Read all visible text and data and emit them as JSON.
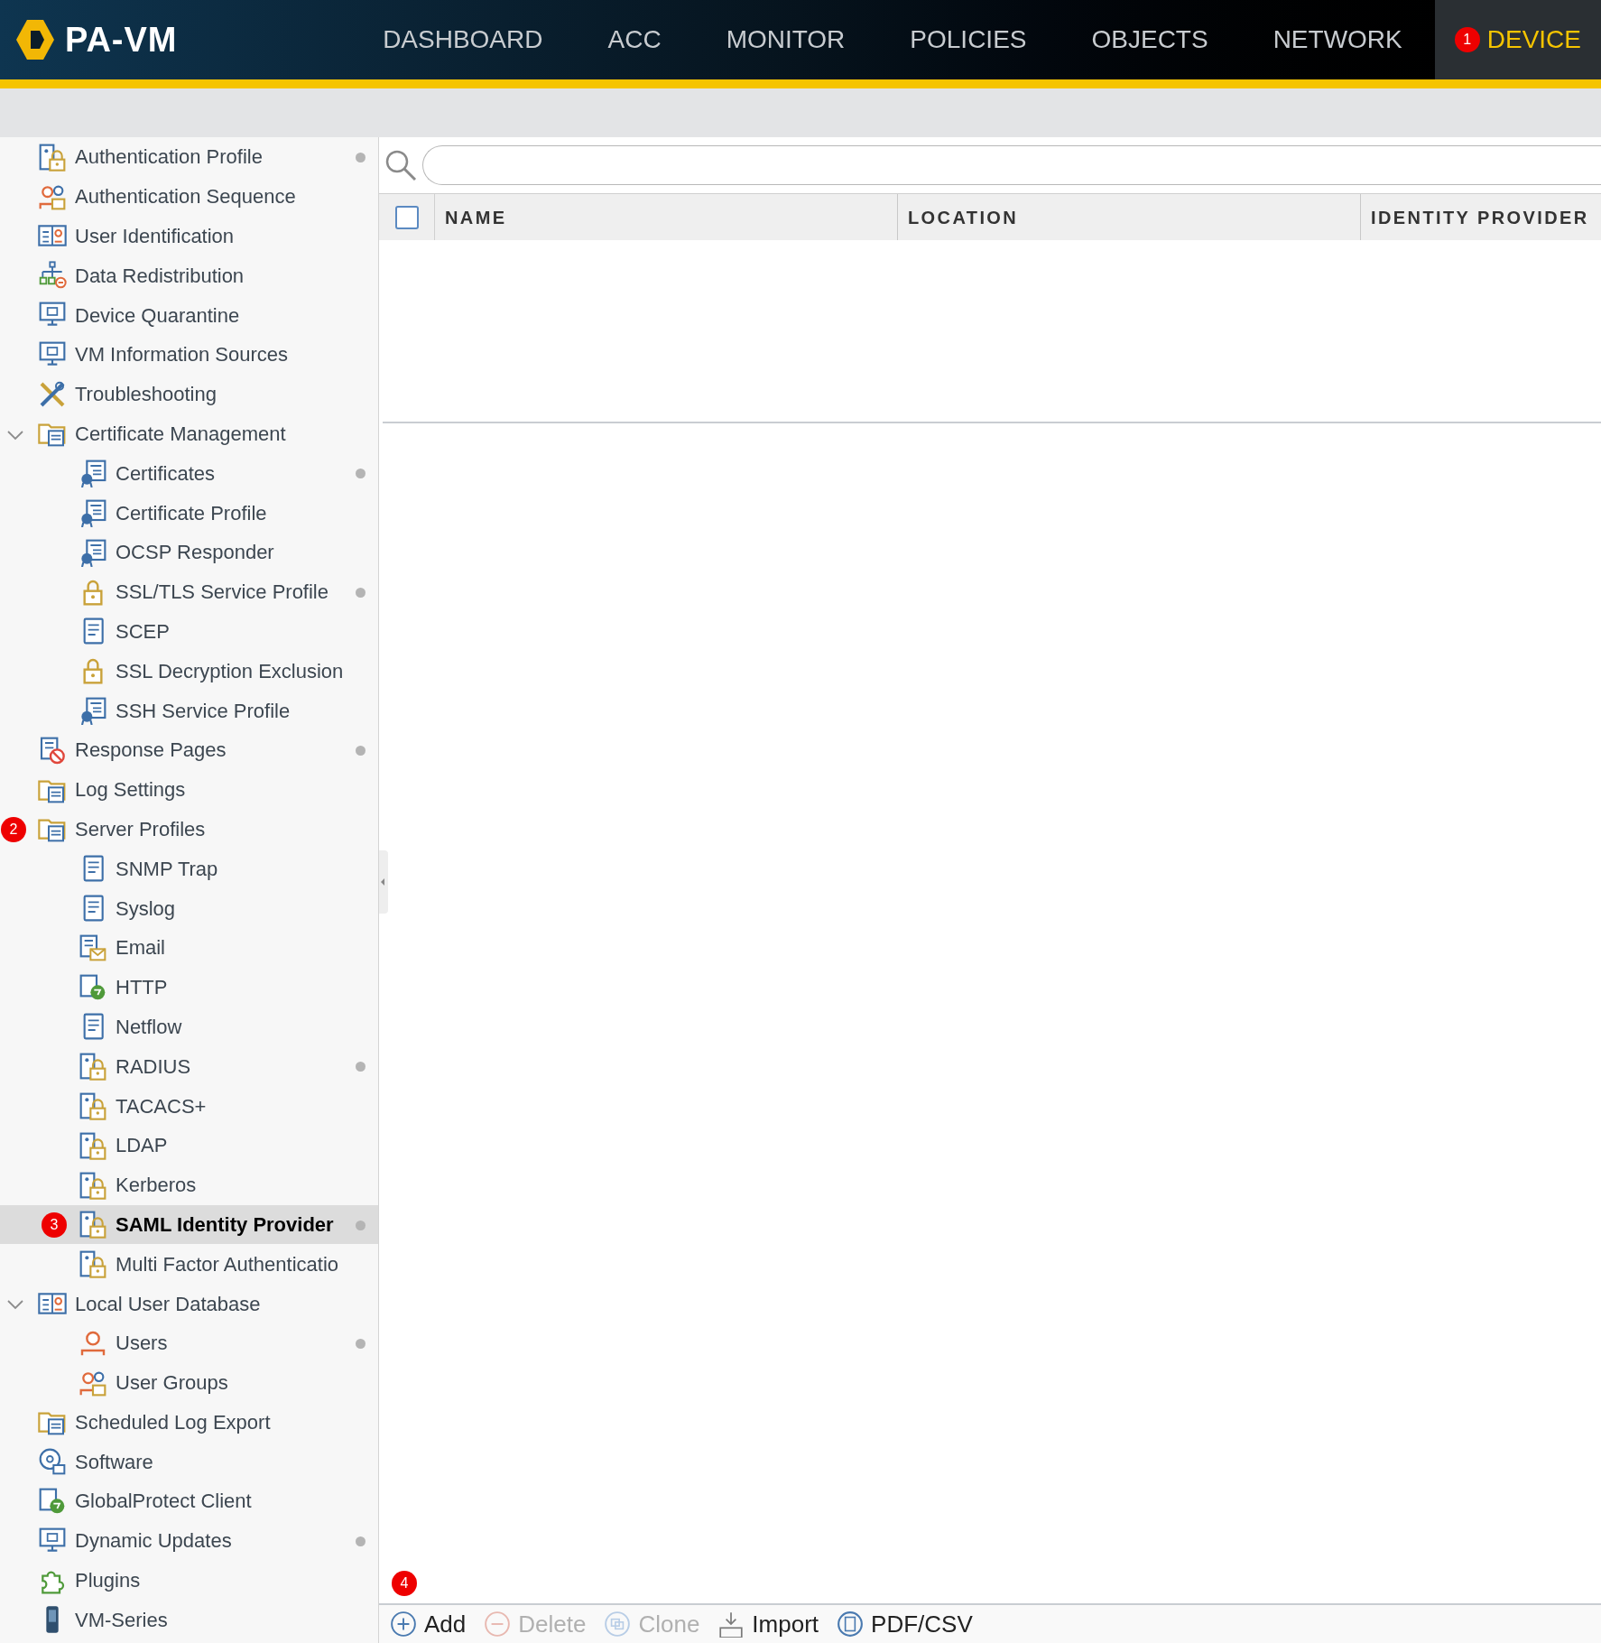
{
  "header": {
    "logo": "PA-VM",
    "nav": [
      {
        "label": "DASHBOARD",
        "selected": false
      },
      {
        "label": "ACC",
        "selected": false
      },
      {
        "label": "MONITOR",
        "selected": false
      },
      {
        "label": "POLICIES",
        "selected": false
      },
      {
        "label": "OBJECTS",
        "selected": false
      },
      {
        "label": "NETWORK",
        "selected": false
      },
      {
        "label": "DEVICE",
        "selected": true,
        "badge": "1"
      }
    ]
  },
  "sidebar": {
    "items": [
      {
        "label": "Authentication Profile",
        "dot": true,
        "selected": false
      },
      {
        "label": "Authentication Sequence",
        "dot": false,
        "selected": false
      },
      {
        "label": "User Identification",
        "dot": false,
        "selected": false
      },
      {
        "label": "Data Redistribution",
        "dot": false,
        "selected": false
      },
      {
        "label": "Device Quarantine",
        "dot": false,
        "selected": false
      },
      {
        "label": "VM Information Sources",
        "dot": false,
        "selected": false
      },
      {
        "label": "Troubleshooting",
        "dot": false,
        "selected": false
      },
      {
        "label": "Certificate Management",
        "dot": false,
        "selected": false,
        "expanded": true,
        "children": [
          {
            "label": "Certificates",
            "dot": true,
            "selected": false
          },
          {
            "label": "Certificate Profile",
            "dot": false,
            "selected": false
          },
          {
            "label": "OCSP Responder",
            "dot": false,
            "selected": false
          },
          {
            "label": "SSL/TLS Service Profile",
            "dot": true,
            "selected": false
          },
          {
            "label": "SCEP",
            "dot": false,
            "selected": false
          },
          {
            "label": "SSL Decryption Exclusion",
            "dot": false,
            "selected": false
          },
          {
            "label": "SSH Service Profile",
            "dot": false,
            "selected": false
          }
        ]
      },
      {
        "label": "Response Pages",
        "dot": true,
        "selected": false
      },
      {
        "label": "Log Settings",
        "dot": false,
        "selected": false
      },
      {
        "label": "Server Profiles",
        "dot": false,
        "selected": false,
        "badge": "2",
        "children": [
          {
            "label": "SNMP Trap",
            "dot": false,
            "selected": false
          },
          {
            "label": "Syslog",
            "dot": false,
            "selected": false
          },
          {
            "label": "Email",
            "dot": false,
            "selected": false
          },
          {
            "label": "HTTP",
            "dot": false,
            "selected": false
          },
          {
            "label": "Netflow",
            "dot": false,
            "selected": false
          },
          {
            "label": "RADIUS",
            "dot": true,
            "selected": false
          },
          {
            "label": "TACACS+",
            "dot": false,
            "selected": false
          },
          {
            "label": "LDAP",
            "dot": false,
            "selected": false
          },
          {
            "label": "Kerberos",
            "dot": false,
            "selected": false
          },
          {
            "label": "SAML Identity Provider",
            "dot": true,
            "selected": true,
            "badge": "3"
          },
          {
            "label": "Multi Factor Authenticatio",
            "dot": false,
            "selected": false
          }
        ]
      },
      {
        "label": "Local User Database",
        "dot": false,
        "selected": false,
        "expanded": true,
        "children": [
          {
            "label": "Users",
            "dot": true,
            "selected": false
          },
          {
            "label": "User Groups",
            "dot": false,
            "selected": false
          }
        ]
      },
      {
        "label": "Scheduled Log Export",
        "dot": false,
        "selected": false
      },
      {
        "label": "Software",
        "dot": false,
        "selected": false
      },
      {
        "label": "GlobalProtect Client",
        "dot": false,
        "selected": false
      },
      {
        "label": "Dynamic Updates",
        "dot": true,
        "selected": false
      },
      {
        "label": "Plugins",
        "dot": false,
        "selected": false
      },
      {
        "label": "VM-Series",
        "dot": false,
        "selected": false
      }
    ]
  },
  "table": {
    "select_all": {
      "checked": false
    },
    "columns": [
      "NAME",
      "LOCATION",
      "IDENTITY PROVIDER"
    ]
  },
  "toolbar": {
    "badge": "4",
    "buttons": [
      {
        "label": "Add",
        "kind": "add",
        "disabled": false
      },
      {
        "label": "Delete",
        "kind": "delete",
        "disabled": true
      },
      {
        "label": "Clone",
        "kind": "clone",
        "disabled": true
      },
      {
        "label": "Import",
        "kind": "import",
        "disabled": false
      },
      {
        "label": "PDF/CSV",
        "kind": "pdf",
        "disabled": false
      }
    ]
  }
}
